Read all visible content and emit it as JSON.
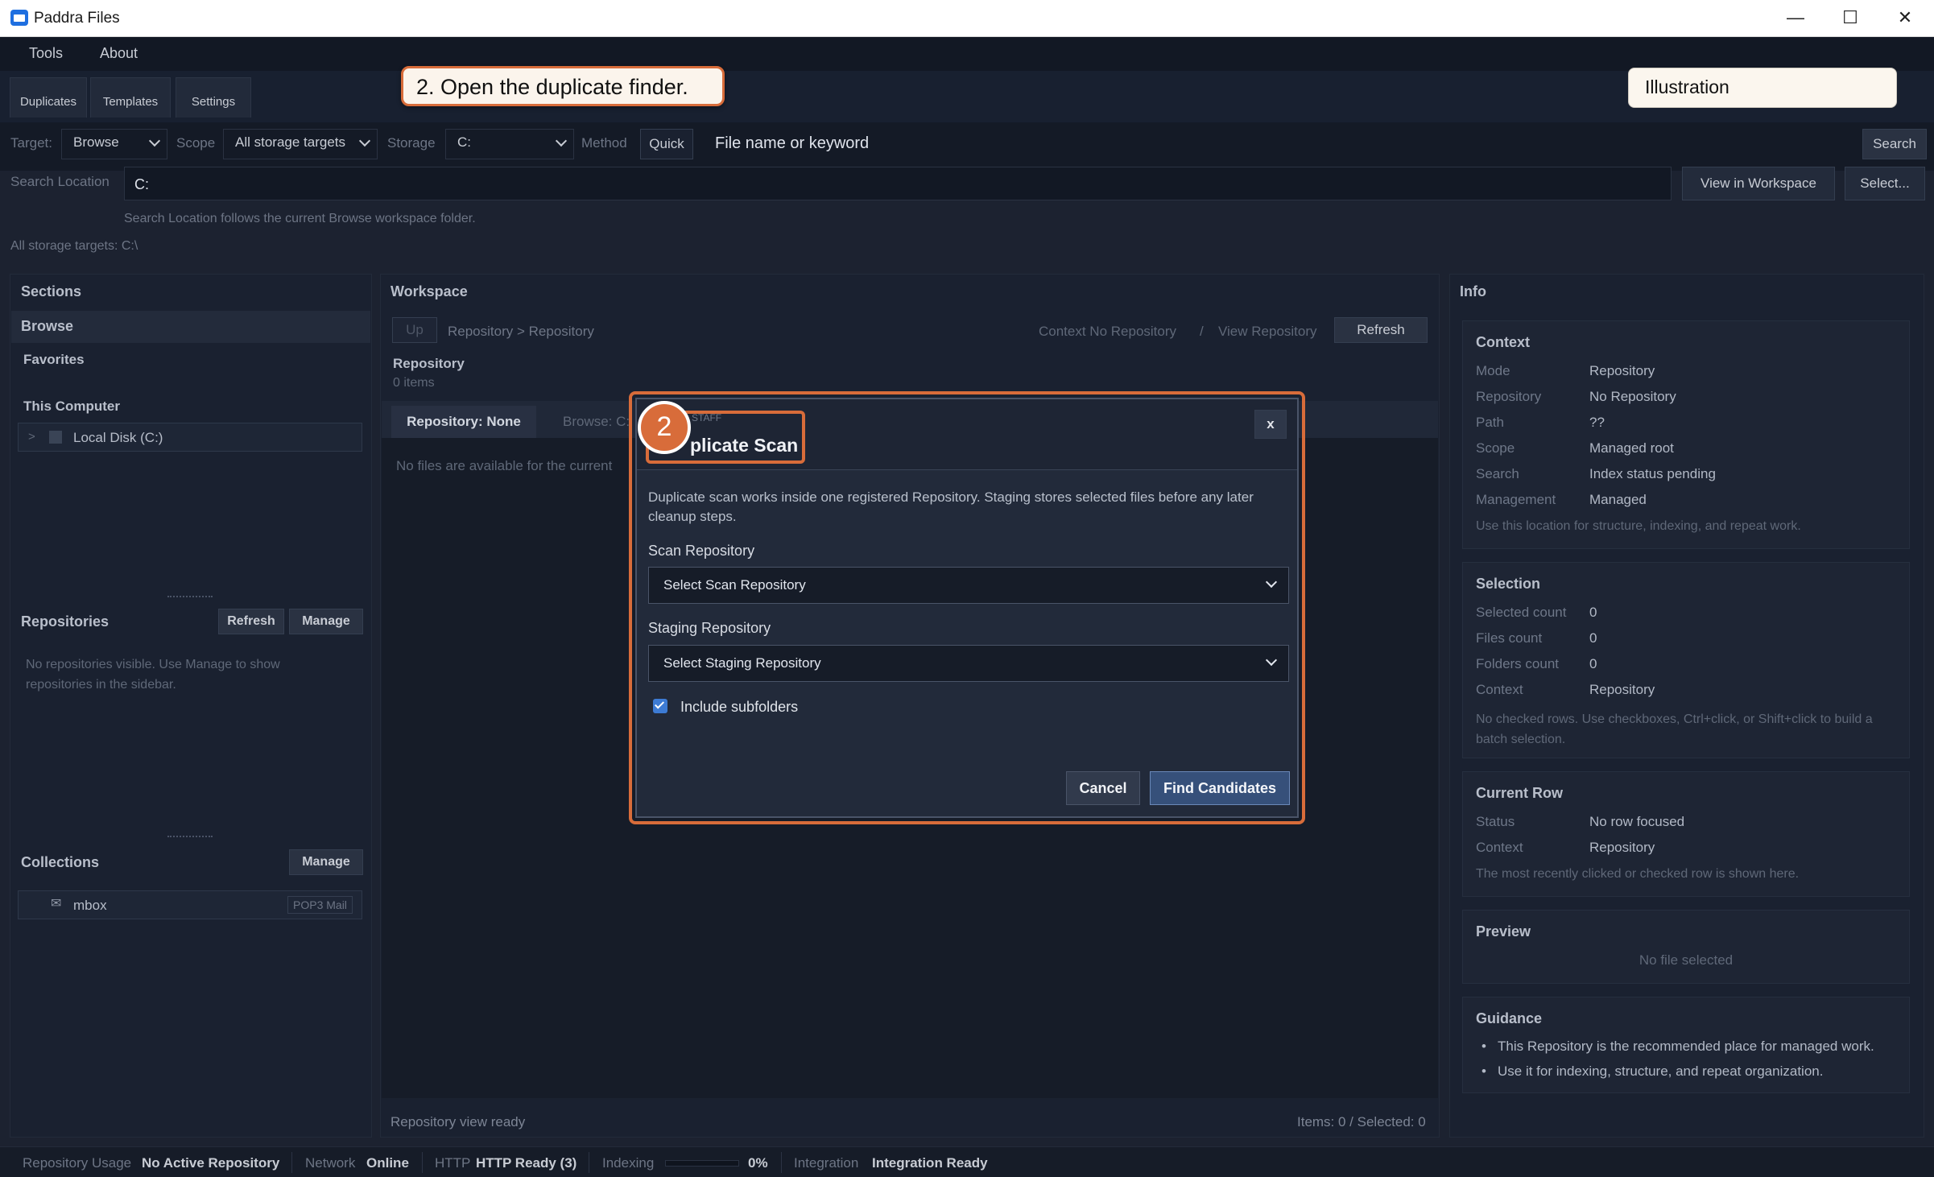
{
  "window": {
    "title": "Paddra Files",
    "minimize": "—",
    "maximize": "☐",
    "close": "✕"
  },
  "menu": {
    "items": [
      "Tools",
      "About"
    ]
  },
  "toolbar": {
    "tabs": [
      "Duplicates",
      "Templates",
      "Settings"
    ]
  },
  "callout": {
    "step_text": "2. Open the duplicate finder.",
    "badge_number": "2"
  },
  "illustration_tag": "Illustration",
  "search": {
    "target_label": "Target:",
    "target_value": "Browse",
    "scope_label": "Scope",
    "scope_value": "All storage targets",
    "storage_label": "Storage",
    "storage_value": "C:",
    "method_label": "Method",
    "method_value": "Quick",
    "keyword_placeholder": "File name or keyword",
    "search_button": "Search",
    "location_label": "Search Location",
    "location_value": "C:",
    "view_in_workspace": "View in Workspace",
    "select_button": "Select...",
    "location_hint": "Search Location follows the current Browse workspace folder.",
    "all_targets": "All storage targets: C:\\"
  },
  "sidebar": {
    "sections_title": "Sections",
    "browse": "Browse",
    "favorites": "Favorites",
    "this_computer": "This Computer",
    "local_disk": "Local Disk (C:)",
    "tree_toggle": ">",
    "repositories_title": "Repositories",
    "repo_refresh": "Refresh",
    "repo_manage": "Manage",
    "repo_empty": "No repositories visible. Use Manage to show repositories in the sidebar.",
    "collections_title": "Collections",
    "collections_manage": "Manage",
    "collection_item": "mbox",
    "collection_badge": "POP3 Mail"
  },
  "workspace": {
    "title": "Workspace",
    "up": "Up",
    "breadcrumb": "Repository > Repository",
    "context": "Context No Repository",
    "separator": "/",
    "view_repository": "View Repository",
    "refresh": "Refresh",
    "heading": "Repository",
    "count": "0 items",
    "tab_active": "Repository: None",
    "tab_other": "Browse: C:",
    "empty_text": "No files are available for the current",
    "status_left": "Repository view ready",
    "status_right": "Items: 0 / Selected: 0"
  },
  "dialog": {
    "eyebrow": "STAFF",
    "title": "Duplicate Scan",
    "title_visible": "plicate Scan",
    "close": "x",
    "description": "Duplicate scan works inside one registered Repository. Staging stores selected files before any later cleanup steps.",
    "scan_label": "Scan Repository",
    "scan_value": "Select Scan Repository",
    "staging_label": "Staging Repository",
    "staging_value": "Select Staging Repository",
    "include_subfolders": "Include subfolders",
    "include_checked": true,
    "cancel": "Cancel",
    "find": "Find Candidates"
  },
  "info": {
    "title": "Info",
    "context": {
      "heading": "Context",
      "rows": [
        {
          "k": "Mode",
          "v": "Repository"
        },
        {
          "k": "Repository",
          "v": "No Repository"
        },
        {
          "k": "Path",
          "v": "??"
        },
        {
          "k": "Scope",
          "v": "Managed root"
        },
        {
          "k": "Search",
          "v": "Index status pending"
        },
        {
          "k": "Management",
          "v": "Managed"
        }
      ],
      "note": "Use this location for structure, indexing, and repeat work."
    },
    "selection": {
      "heading": "Selection",
      "rows": [
        {
          "k": "Selected count",
          "v": "0"
        },
        {
          "k": "Files count",
          "v": "0"
        },
        {
          "k": "Folders count",
          "v": "0"
        },
        {
          "k": "Context",
          "v": "Repository"
        }
      ],
      "note": "No checked rows. Use checkboxes, Ctrl+click, or Shift+click to build a batch selection."
    },
    "current_row": {
      "heading": "Current Row",
      "rows": [
        {
          "k": "Status",
          "v": "No row focused"
        },
        {
          "k": "Context",
          "v": "Repository"
        }
      ],
      "note": "The most recently clicked or checked row is shown here."
    },
    "preview": {
      "heading": "Preview",
      "empty": "No file selected"
    },
    "guidance": {
      "heading": "Guidance",
      "items": [
        "This Repository is the recommended place for managed work.",
        "Use it for indexing, structure, and repeat organization."
      ]
    }
  },
  "statusbar": {
    "repo_usage_label": "Repository Usage",
    "repo_usage_value": "No Active Repository",
    "network_label": "Network",
    "network_value": "Online",
    "http_label": "HTTP",
    "http_value": "HTTP Ready (3)",
    "indexing_label": "Indexing",
    "indexing_value": "0%",
    "indexing_progress": 0,
    "integration_label": "Integration",
    "integration_value": "Integration Ready"
  }
}
